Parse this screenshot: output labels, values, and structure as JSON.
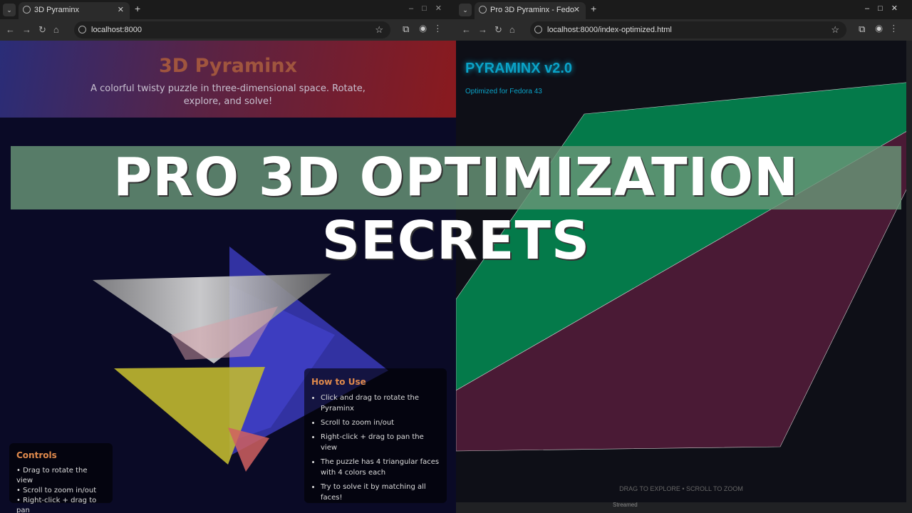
{
  "left": {
    "tab_title": "3D Pyraminx",
    "url": "localhost:8000",
    "header": {
      "title": "3D Pyraminx",
      "subtitle": "A colorful twisty puzzle in three-dimensional space. Rotate, explore, and solve!"
    },
    "controls": {
      "title": "Controls",
      "items": [
        "• Drag to rotate the view",
        "• Scroll to zoom in/out",
        "• Right-click + drag to pan"
      ]
    },
    "how_to_use": {
      "title": "How to Use",
      "items": [
        "Click and drag to rotate the Pyraminx",
        "Scroll to zoom in/out",
        "Right-click + drag to pan the view",
        "The puzzle has 4 triangular faces with 4 colors each",
        "Try to solve it by matching all faces!"
      ]
    }
  },
  "right": {
    "tab_title": "Pro 3D Pyraminx - Fedo",
    "url": "localhost:8000/index-optimized.html",
    "title": "PYRAMINX v2.0",
    "subtitle": "Optimized for Fedora 43",
    "hint": "DRAG TO EXPLORE • SCROLL TO ZOOM",
    "status": "Streamed"
  },
  "banner": "PRO 3D OPTIMIZATION SECRETS"
}
